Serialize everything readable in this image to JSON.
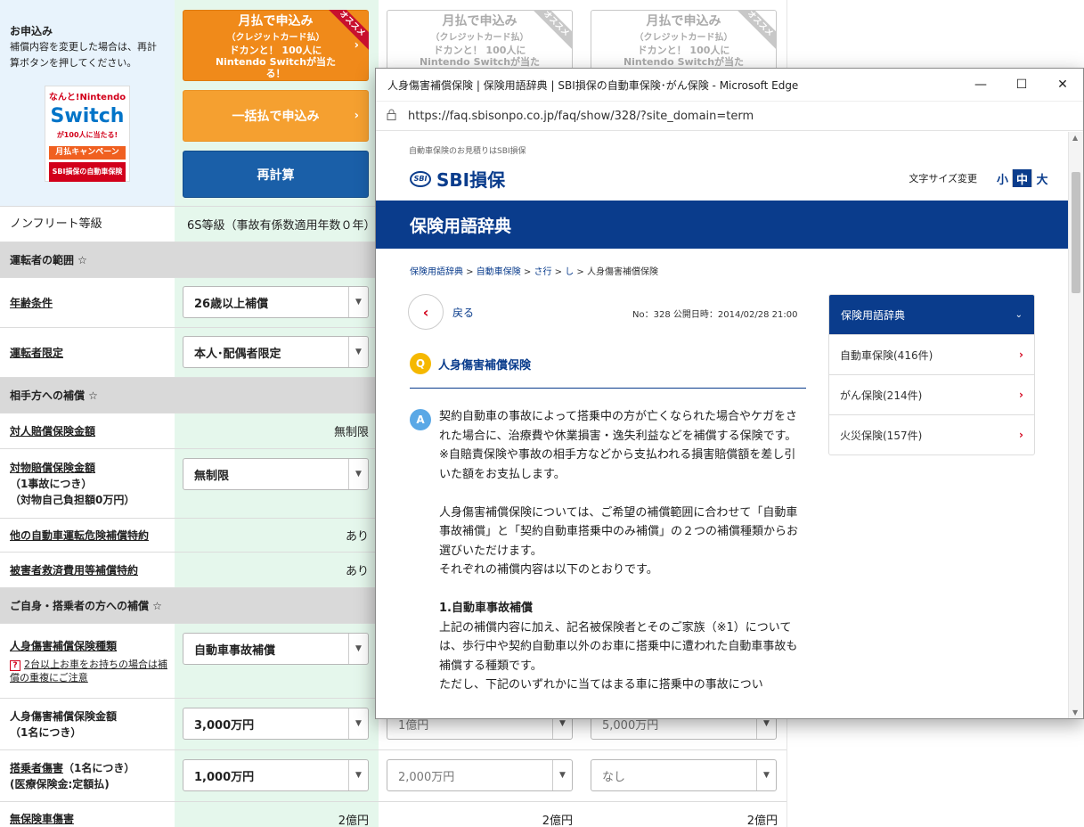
{
  "left": {
    "apply": {
      "title": "お申込み",
      "desc": "補償内容を変更した場合は、再計算ボタンを押してください。",
      "promo": {
        "line1": "なんと!Nintendo",
        "line2": "Switch",
        "line3": "が100人に当たる!",
        "line4": "月払キャンペーン",
        "line5": "SBI損保の自動車保険"
      },
      "btn_monthly_title": "月払で申込み",
      "btn_monthly_sub": "（クレジットカード払）",
      "btn_monthly_note": "ドカンと！ 100人に Nintendo Switchが当たる！",
      "ribbon": "オススメ",
      "btn_lump": "一括払で申込み",
      "btn_recalc": "再計算"
    },
    "nonfleet": {
      "label": "ノンフリート等級",
      "value": "6S等級（事故有係数適用年数０年）"
    },
    "sec_driver": "運転者の範囲 ☆",
    "age": {
      "label": "年齢条件",
      "value": "26歳以上補償"
    },
    "limit": {
      "label": "運転者限定",
      "value": "本人･配偶者限定"
    },
    "sec_other": "相手方への補償 ☆",
    "bodily": {
      "label": "対人賠償保険金額",
      "value": "無制限"
    },
    "property": {
      "label": "対物賠償保険金額",
      "sub1": "（1事故につき）",
      "sub2": "（対物自己負担額0万円）",
      "value": "無制限"
    },
    "other_car": {
      "label": "他の自動車運転危険補償特約",
      "value": "あり"
    },
    "victim": {
      "label": "被害者救済費用等補償特約",
      "value": "あり"
    },
    "sec_self": "ご自身・搭乗者の方への補償 ☆",
    "pi_type": {
      "label": "人身傷害補償保険種類",
      "help": "2台以上お車をお持ちの場合は補償の重複にご注意",
      "value": "自動車事故補償"
    },
    "pi_amount": {
      "label": "人身傷害補償保険金額",
      "sub": "（1名につき）",
      "v1": "3,000万円",
      "v2": "1億円",
      "v3": "5,000万円"
    },
    "passenger": {
      "label": "搭乗者傷害",
      "label2": "（1名につき）",
      "sub": "(医療保険金:定額払)",
      "v1": "1,000万円",
      "v2": "2,000万円",
      "v3": "なし"
    },
    "uninsured": {
      "label": "無保険車傷害",
      "v1": "2億円",
      "v2": "2億円",
      "v3": "2億円"
    }
  },
  "browser": {
    "title": "人身傷害補償保険 | 保険用語辞典 | SBI損保の自動車保険･がん保険 - Microsoft Edge",
    "url": "https://faq.sbisonpo.co.jp/faq/show/328/?site_domain=term",
    "ctrl": {
      "min": "—",
      "max": "☐",
      "close": "✕"
    }
  },
  "page": {
    "tagline": "自動車保険のお見積りはSBI損保",
    "logo_mark": "SBI",
    "logo": "SBI損保",
    "fontsize_label": "文字サイズ変更",
    "fs_small": "小",
    "fs_mid": "中",
    "fs_large": "大",
    "hero": "保険用語辞典",
    "breadcrumb": [
      "保険用語辞典",
      "自動車保険",
      "さ行",
      "し",
      "人身傷害補償保険"
    ],
    "back": "戻る",
    "meta": "No：328 公開日時：2014/02/28 21:00",
    "question": "人身傷害補償保険",
    "answer": [
      "契約自動車の事故によって搭乗中の方が亡くなられた場合やケガをされた場合に、治療費や休業損害・逸失利益などを補償する保険です。",
      "※自賠責保険や事故の相手方などから支払われる損害賠償額を差し引いた額をお支払します。",
      "人身傷害補償保険については、ご希望の補償範囲に合わせて「自動車事故補償」と「契約自動車搭乗中のみ補償」の２つの補償種類からお選びいただけます。",
      "それぞれの補償内容は以下のとおりです。",
      "1.自動車事故補償",
      "上記の補償内容に加え、記名被保険者とそのご家族（※1）については、歩行中や契約自動車以外のお車に搭乗中に遭われた自動車事故も補償する種類です。",
      "ただし、下記のいずれかに当てはまる車に搭乗中の事故につい"
    ],
    "side": {
      "header": "保険用語辞典",
      "items": [
        "自動車保険(416件)",
        "がん保険(214件)",
        "火災保険(157件)"
      ]
    }
  }
}
